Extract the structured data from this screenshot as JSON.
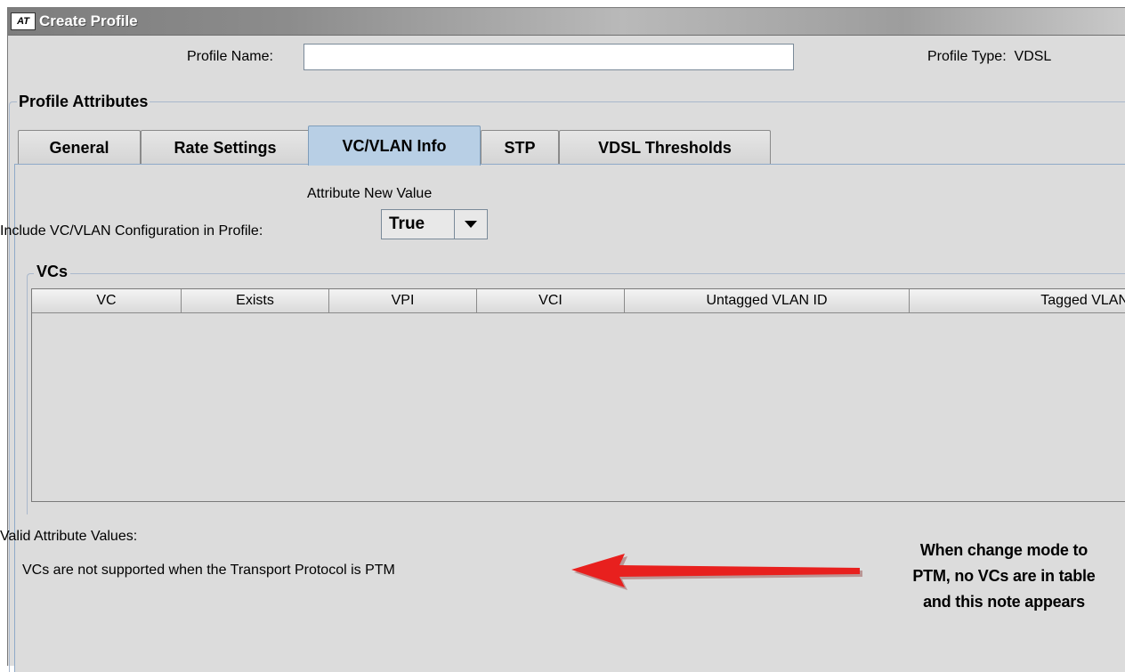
{
  "window": {
    "title": "Create Profile"
  },
  "header": {
    "profile_name_label": "Profile Name:",
    "profile_name_value": "",
    "profile_type_label": "Profile Type:",
    "profile_type_value": "VDSL"
  },
  "attributes": {
    "group_title": "Profile Attributes",
    "tabs": [
      {
        "label": "General",
        "active": false
      },
      {
        "label": "Rate Settings",
        "active": false
      },
      {
        "label": "VC/VLAN Info",
        "active": true
      },
      {
        "label": "STP",
        "active": false
      },
      {
        "label": "VDSL Thresholds",
        "active": false
      }
    ]
  },
  "vc_vlan": {
    "column_header": "Attribute New Value",
    "include_label": "Include VC/VLAN Configuration in Profile:",
    "include_value": "True",
    "vcs_title": "VCs",
    "table_columns": [
      "VC",
      "Exists",
      "VPI",
      "VCI",
      "Untagged VLAN ID",
      "Tagged VLAN"
    ],
    "rows": [],
    "valid_values_label": "Valid Attribute Values:",
    "valid_values_note": "VCs are not supported when the Transport Protocol is PTM"
  },
  "annotation": {
    "lines": [
      "When change mode to",
      "PTM, no VCs are in table",
      "and this note appears"
    ],
    "arrow_color": "#e8201e"
  }
}
